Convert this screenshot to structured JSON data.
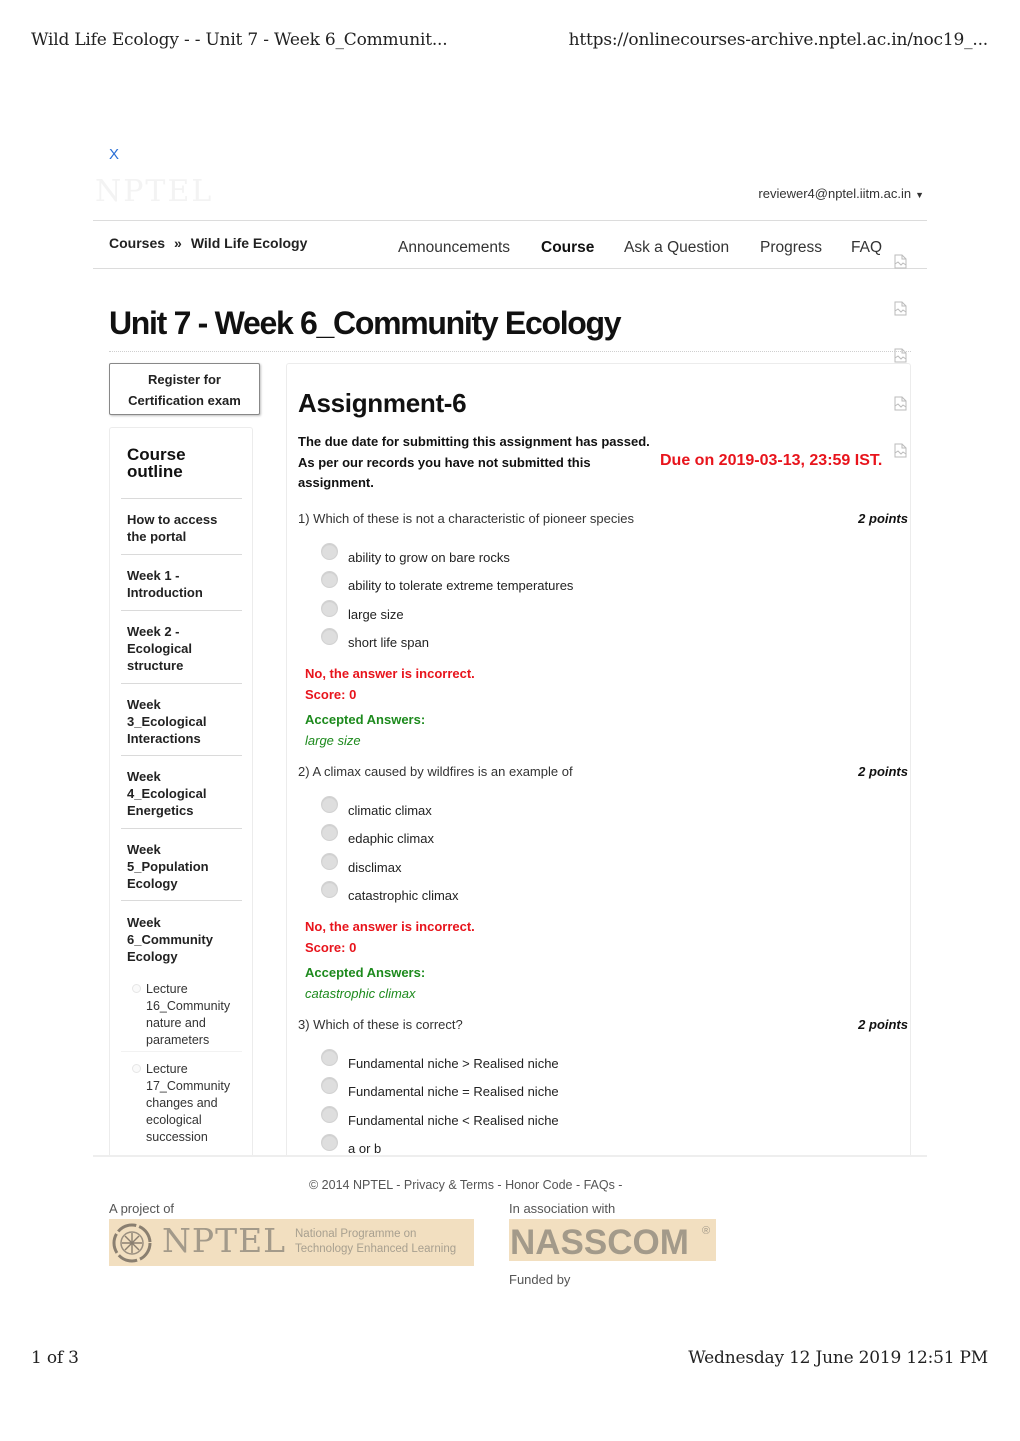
{
  "print_header": {
    "title": "Wild Life Ecology - - Unit 7 - Week 6_Communit...",
    "url": "https://onlinecourses-archive.nptel.ac.in/noc19_..."
  },
  "print_footer": {
    "page": "1 of 3",
    "datetime": "Wednesday 12 June 2019 12:51 PM"
  },
  "header": {
    "close_label": "X",
    "logo_text": "NPTEL",
    "user_email": "reviewer4@nptel.iitm.ac.in",
    "user_caret": "▼"
  },
  "breadcrumb": {
    "root": "Courses",
    "separator": "»",
    "course": "Wild Life Ecology"
  },
  "nav": [
    {
      "label": "Announcements",
      "active": false
    },
    {
      "label": "Course",
      "active": true
    },
    {
      "label": "Ask a Question",
      "active": false
    },
    {
      "label": "Progress",
      "active": false
    },
    {
      "label": "FAQ",
      "active": false
    }
  ],
  "page_title": "Unit 7 - Week 6_Community Ecology",
  "register_button": {
    "line1": "Register for",
    "line2": "Certification exam"
  },
  "sidebar": {
    "title_line1": "Course",
    "title_line2": "outline",
    "items": [
      {
        "label": "How to access the portal"
      },
      {
        "label": "Week 1 - Introduction"
      },
      {
        "label": "Week 2 - Ecological structure"
      },
      {
        "label": "Week 3_Ecological Interactions"
      },
      {
        "label": "Week 4_Ecological Energetics"
      },
      {
        "label": "Week 5_Population Ecology"
      },
      {
        "label": "Week 6_Community Ecology"
      }
    ],
    "subitems": [
      {
        "label": "Lecture 16_Community nature and parameters"
      },
      {
        "label": "Lecture 17_Community changes and ecological succession"
      }
    ]
  },
  "assignment": {
    "title": "Assignment-6",
    "notice_line1": "The due date for submitting this assignment has passed.",
    "notice_line2": "As per our records you have not submitted this assignment.",
    "due": "Due on 2019-03-13, 23:59 IST."
  },
  "questions": [
    {
      "text": "1) Which of these is not a characteristic of pioneer species",
      "points": "2 points",
      "options": [
        "ability to grow on bare rocks",
        "ability to tolerate extreme temperatures",
        "large size",
        "short life span"
      ],
      "result": "No, the answer is incorrect.",
      "score": "Score: 0",
      "accepted_label": "Accepted Answers:",
      "accepted": "large size"
    },
    {
      "text": "2) A climax caused by wildfires is an example of",
      "points": "2 points",
      "options": [
        "climatic climax",
        "edaphic climax",
        "disclimax",
        "catastrophic climax"
      ],
      "result": "No, the answer is incorrect.",
      "score": "Score: 0",
      "accepted_label": "Accepted Answers:",
      "accepted": "catastrophic climax"
    },
    {
      "text": "3) Which of these is correct?",
      "points": "2 points",
      "options": [
        "Fundamental niche > Realised niche",
        "Fundamental niche = Realised niche",
        "Fundamental niche < Realised niche",
        "a or b"
      ]
    }
  ],
  "footer": {
    "copyright": "© 2014 NPTEL - Privacy & Terms - Honor Code - FAQs -",
    "project_of": "A project of",
    "association": "In association with",
    "funded_by": "Funded by",
    "nptel_logo": {
      "name": "NPTEL",
      "tagline1": "National Programme on",
      "tagline2": "Technology Enhanced Learning"
    },
    "nasscom_logo": {
      "name": "NASSCOM",
      "mark": "®"
    }
  },
  "colors": {
    "link_blue": "#2a6fd6",
    "error_red": "#e8141c",
    "success_green": "#1d8a1d",
    "logo_bg": "#f2dfc0",
    "logo_fg": "#a39a8a"
  }
}
